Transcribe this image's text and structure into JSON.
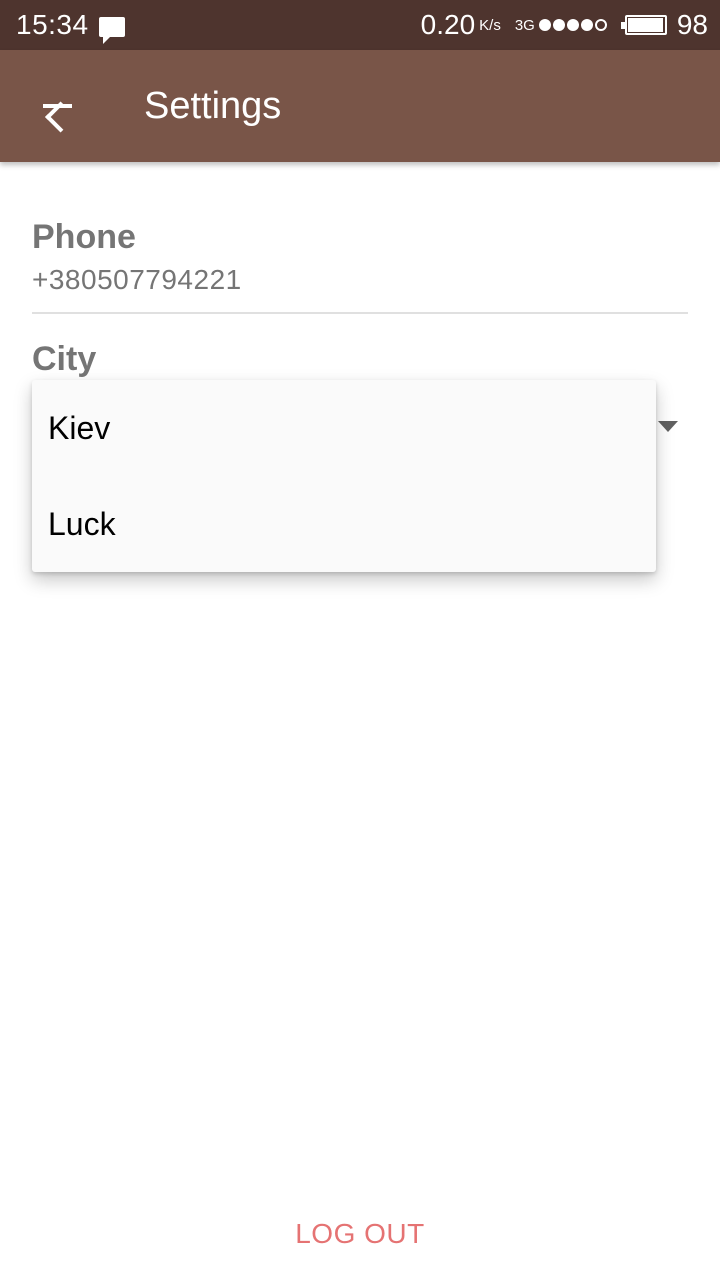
{
  "status_bar": {
    "time": "15:34",
    "speed": "0.20",
    "speed_unit": "K/s",
    "network_type": "3G",
    "battery_percent": "98",
    "battery_level": 0.98,
    "signal_bars_filled": 4,
    "signal_bars_total": 5
  },
  "app_bar": {
    "title": "Settings",
    "background_color": "#795548"
  },
  "form": {
    "phone_label": "Phone",
    "phone_value": "+380507794221",
    "city_label": "City"
  },
  "city_dropdown": {
    "options": [
      "Kiev",
      "Luck"
    ]
  },
  "footer": {
    "logout_label": "LOG OUT",
    "logout_color": "#e57373"
  }
}
